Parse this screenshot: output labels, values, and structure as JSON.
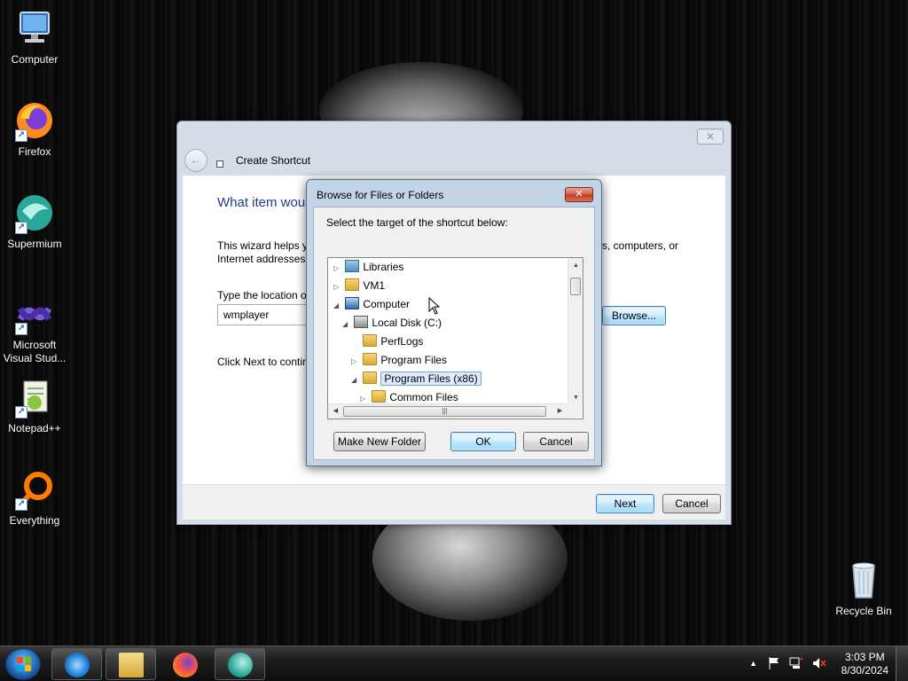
{
  "desktop": {
    "icons": [
      {
        "label": "Computer"
      },
      {
        "label": "Firefox"
      },
      {
        "label": "Supermium"
      },
      {
        "label": "Microsoft Visual Stud..."
      },
      {
        "label": "Notepad++"
      },
      {
        "label": "Everything"
      }
    ],
    "recycle_bin": "Recycle Bin"
  },
  "wizard": {
    "close_glyph": "✕",
    "back_glyph": "←",
    "title": "Create Shortcut",
    "heading": "What item wou",
    "intro": "This wizard helps yo",
    "intro_right": "s, computers, or",
    "intro_line2": "Internet addresses.",
    "location_label": "Type the location o",
    "location_value": "wmplayer",
    "browse_label": "Browse...",
    "click_next": "Click Next to contin",
    "next_label": "Next",
    "cancel_label": "Cancel"
  },
  "browse_dialog": {
    "title": "Browse for Files or Folders",
    "close_glyph": "✕",
    "instruction": "Select the target of the shortcut below:",
    "tree": [
      {
        "label": "Libraries",
        "expander": "▷",
        "icon": "libraries-icon",
        "level": 0
      },
      {
        "label": "VM1",
        "expander": "▷",
        "icon": "folder-icon",
        "level": 0
      },
      {
        "label": "Computer",
        "expander": "◢",
        "icon": "computer-icon",
        "level": 0
      },
      {
        "label": "Local Disk (C:)",
        "expander": "◢",
        "icon": "disk-icon",
        "level": 1
      },
      {
        "label": "PerfLogs",
        "expander": "",
        "icon": "folder-icon",
        "level": 2
      },
      {
        "label": "Program Files",
        "expander": "▷",
        "icon": "folder-icon",
        "level": 2
      },
      {
        "label": "Program Files (x86)",
        "expander": "◢",
        "icon": "folder-icon",
        "level": 2,
        "selected": true
      },
      {
        "label": "Common Files",
        "expander": "▷",
        "icon": "folder-icon",
        "level": 3
      }
    ],
    "make_folder_label": "Make New Folder",
    "ok_label": "OK",
    "cancel_label": "Cancel",
    "scroll_up": "▲",
    "scroll_down": "▼",
    "scroll_left": "◀",
    "scroll_right": "▶",
    "thumb_grip": "|||"
  },
  "taskbar": {
    "time": "3:03 PM",
    "date": "8/30/2024",
    "tray_arrow": "▲"
  }
}
